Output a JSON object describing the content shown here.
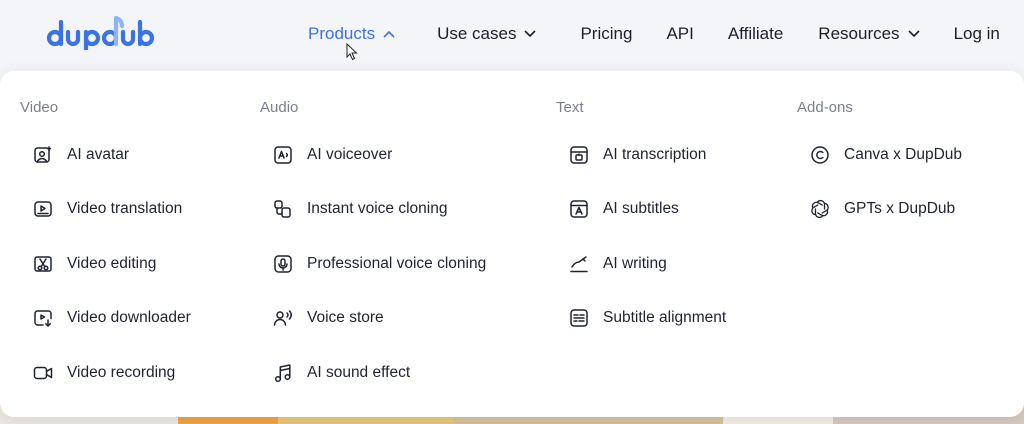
{
  "brand": {
    "name": "dupdub",
    "color": "#3b73e6"
  },
  "nav": {
    "products": "Products",
    "use_cases": "Use cases",
    "pricing": "Pricing",
    "api": "API",
    "affiliate": "Affiliate",
    "resources": "Resources",
    "login": "Log in"
  },
  "menu": {
    "video": {
      "title": "Video",
      "items": [
        {
          "label": "AI avatar",
          "icon": "avatar-icon"
        },
        {
          "label": "Video translation",
          "icon": "video-translation-icon"
        },
        {
          "label": "Video editing",
          "icon": "scissors-icon"
        },
        {
          "label": "Video downloader",
          "icon": "download-icon"
        },
        {
          "label": "Video recording",
          "icon": "camera-icon"
        }
      ]
    },
    "audio": {
      "title": "Audio",
      "items": [
        {
          "label": "AI voiceover",
          "icon": "voiceover-icon"
        },
        {
          "label": "Instant voice cloning",
          "icon": "voice-clone-icon"
        },
        {
          "label": "Professional voice cloning",
          "icon": "microphone-icon"
        },
        {
          "label": "Voice store",
          "icon": "users-voice-icon"
        },
        {
          "label": "AI sound effect",
          "icon": "music-note-icon"
        }
      ]
    },
    "text": {
      "title": "Text",
      "items": [
        {
          "label": "AI transcription",
          "icon": "transcription-icon"
        },
        {
          "label": "AI subtitles",
          "icon": "subtitles-icon"
        },
        {
          "label": "AI writing",
          "icon": "writing-icon"
        },
        {
          "label": "Subtitle alignment",
          "icon": "alignment-icon"
        }
      ]
    },
    "addons": {
      "title": "Add-ons",
      "items": [
        {
          "label": "Canva x DupDub",
          "icon": "canva-icon"
        },
        {
          "label": "GPTs x DupDub",
          "icon": "openai-icon"
        }
      ]
    }
  }
}
